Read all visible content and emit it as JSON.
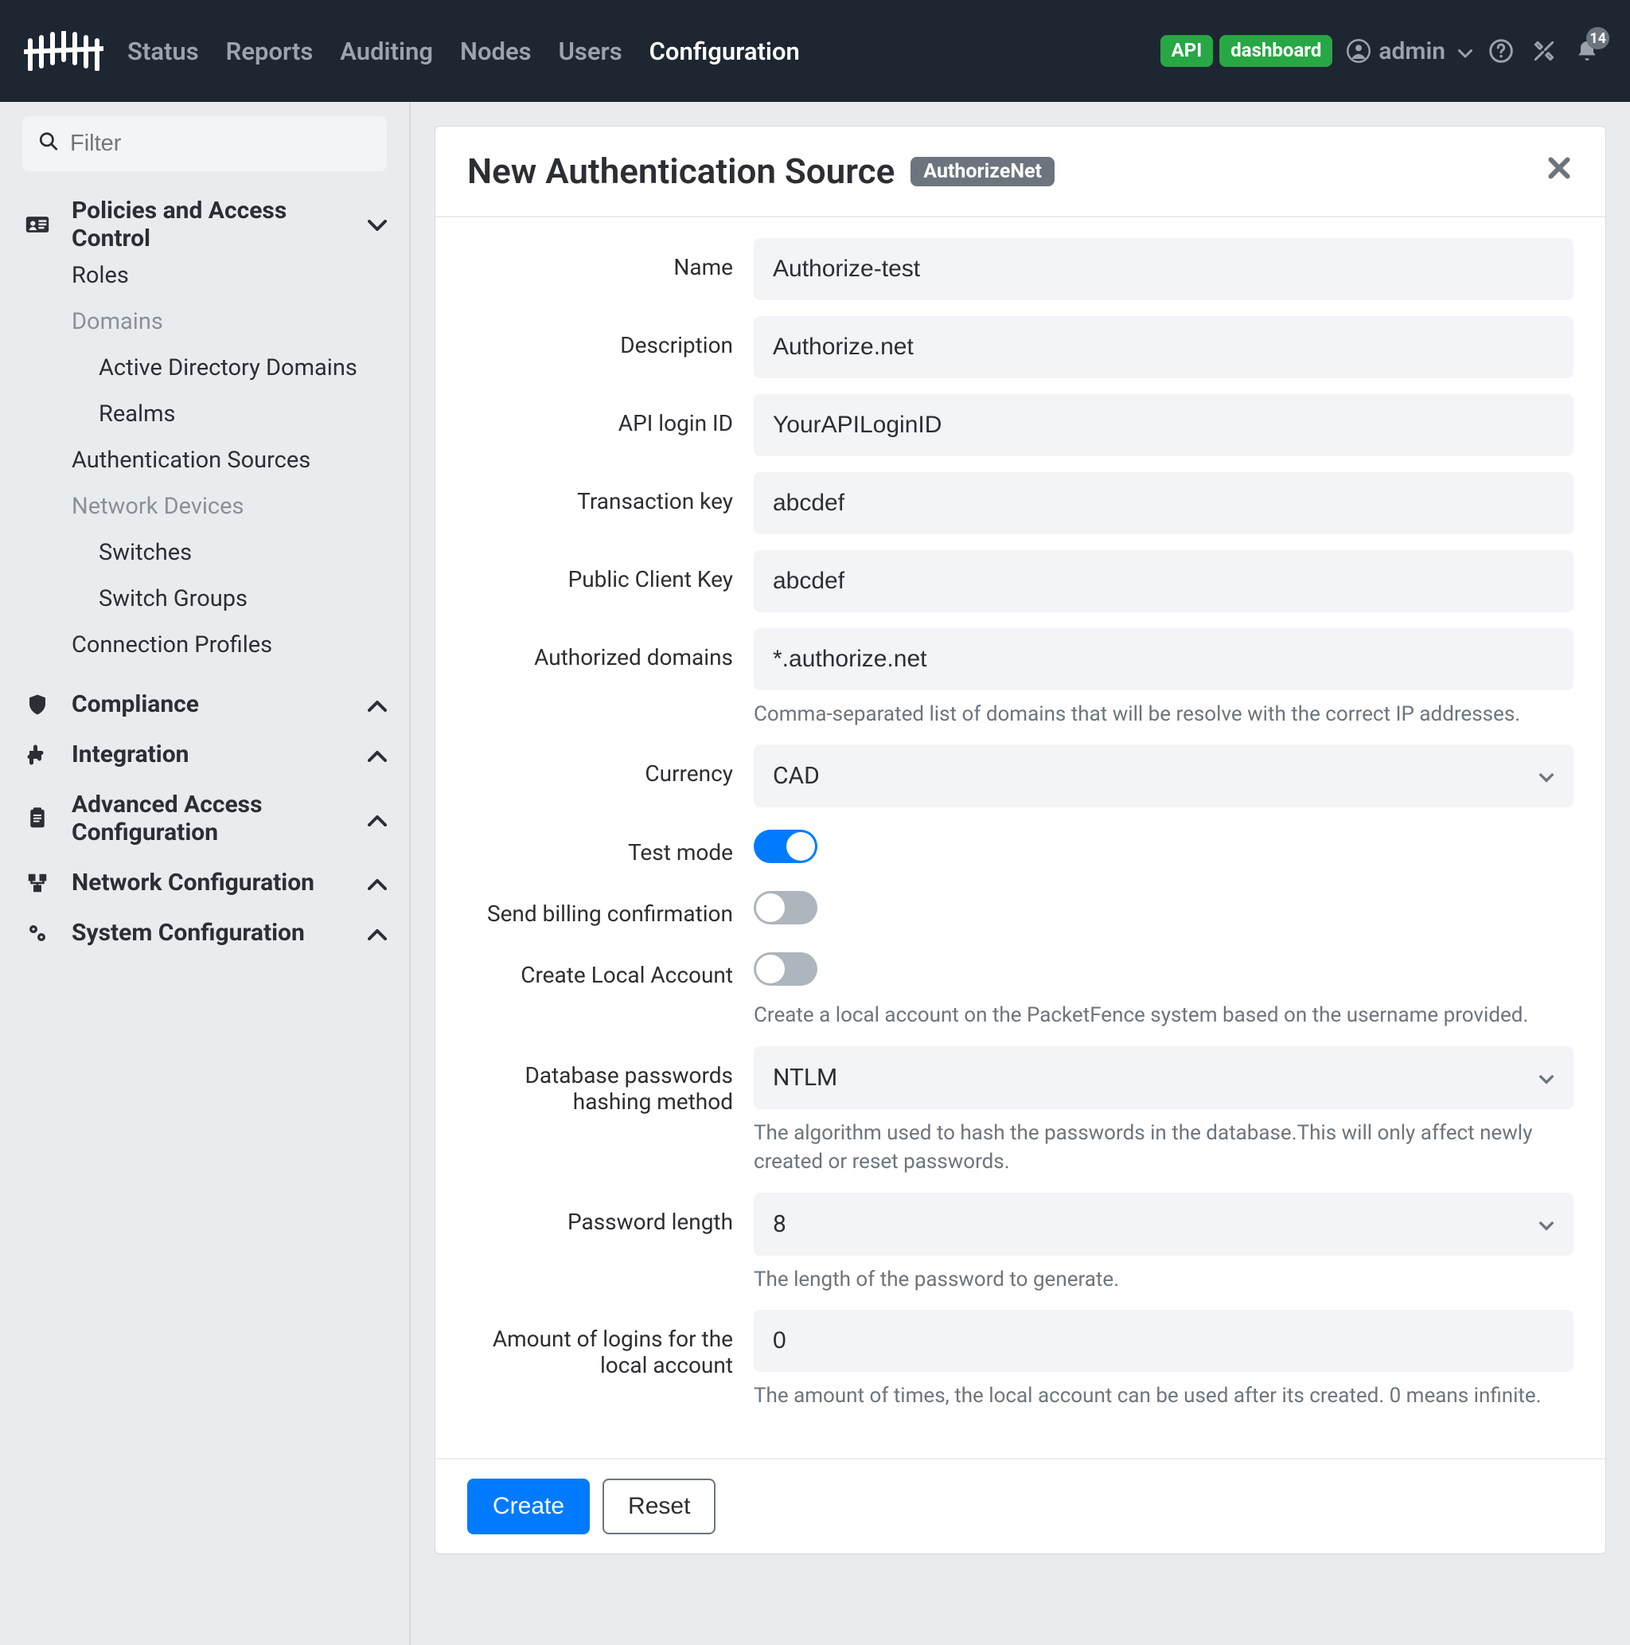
{
  "nav": {
    "items": [
      "Status",
      "Reports",
      "Auditing",
      "Nodes",
      "Users",
      "Configuration"
    ],
    "active": "Configuration"
  },
  "top": {
    "pill_api": "API",
    "pill_dash": "dashboard",
    "user": "admin",
    "notif_count": "14"
  },
  "sidebar": {
    "filter_placeholder": "Filter",
    "sec_policies": "Policies and Access Control",
    "link_roles": "Roles",
    "grp_domains": "Domains",
    "link_ad": "Active Directory Domains",
    "link_realms": "Realms",
    "link_authsrc": "Authentication Sources",
    "grp_netdev": "Network Devices",
    "link_switches": "Switches",
    "link_swgroups": "Switch Groups",
    "link_connprof": "Connection Profiles",
    "sec_compliance": "Compliance",
    "sec_integration": "Integration",
    "sec_advaccess": "Advanced Access Configuration",
    "sec_netconf": "Network Configuration",
    "sec_sysconf": "System Configuration"
  },
  "page": {
    "title": "New Authentication Source",
    "tag": "AuthorizeNet"
  },
  "form": {
    "name": {
      "label": "Name",
      "value": "Authorize-test"
    },
    "description": {
      "label": "Description",
      "value": "Authorize.net"
    },
    "api_login": {
      "label": "API login ID",
      "value": "YourAPILoginID"
    },
    "txn_key": {
      "label": "Transaction key",
      "value": "abcdef"
    },
    "pubkey": {
      "label": "Public Client Key",
      "value": "abcdef"
    },
    "authdomains": {
      "label": "Authorized domains",
      "value": "*.authorize.net",
      "help": "Comma-separated list of domains that will be resolve with the correct IP addresses."
    },
    "currency": {
      "label": "Currency",
      "value": "CAD"
    },
    "testmode": {
      "label": "Test mode",
      "on": true
    },
    "billing": {
      "label": "Send billing confirmation",
      "on": false
    },
    "localacct": {
      "label": "Create Local Account",
      "on": false,
      "help": "Create a local account on the PacketFence system based on the username provided."
    },
    "hashmethod": {
      "label": "Database passwords hashing method",
      "value": "NTLM",
      "help": "The algorithm used to hash the passwords in the database.This will only affect newly created or reset passwords."
    },
    "pwdlen": {
      "label": "Password length",
      "value": "8",
      "help": "The length of the password to generate."
    },
    "logins": {
      "label": "Amount of logins for the local account",
      "value": "0",
      "help": "The amount of times, the local account can be used after its created. 0 means infinite."
    }
  },
  "buttons": {
    "create": "Create",
    "reset": "Reset"
  }
}
